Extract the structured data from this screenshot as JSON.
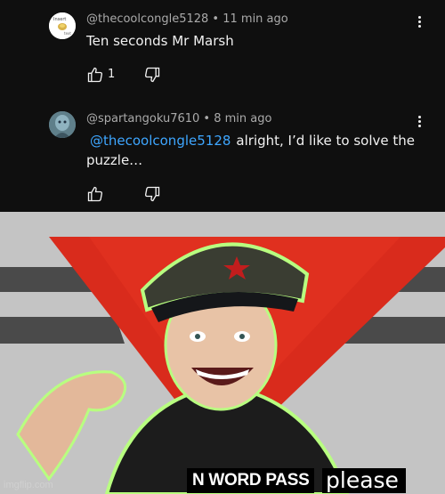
{
  "comments": [
    {
      "author": "@thecoolcongle5128",
      "time": "11 min ago",
      "mention": "",
      "text": "Ten seconds Mr Marsh",
      "likes": "1",
      "avatar_icon": "sticker-avatar"
    },
    {
      "author": "@spartangoku7610",
      "time": "8 min ago",
      "mention": "@thecoolcongle5128",
      "text": "alright, I’d like to solve the puzzle…",
      "likes": "",
      "avatar_icon": "user-avatar"
    }
  ],
  "separator": " • ",
  "meme": {
    "caption_main": "N WORD PASS",
    "caption_please": "please",
    "watermark": "imgflip.com"
  },
  "colors": {
    "background": "#0f0f0f",
    "mention": "#3ea6ff",
    "secondary_text": "#aaaaaa",
    "banner_red": "#d92b1c"
  },
  "icons": [
    "kebab-menu-icon",
    "thumbs-up-icon",
    "thumbs-down-icon"
  ]
}
